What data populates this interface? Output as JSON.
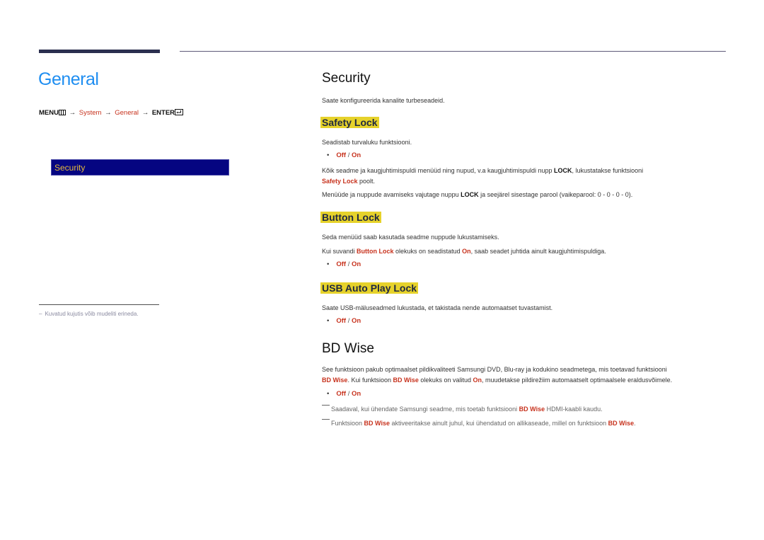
{
  "chapter": {
    "title": "General",
    "menu_path": {
      "menu": "MENU",
      "arrow": "→",
      "system": "System",
      "general": "General",
      "enter": "ENTER"
    },
    "osd_item": "Security",
    "side_note_dash": "–",
    "side_note": "Kuvatud kujutis võib mudeliti erineda."
  },
  "security": {
    "title": "Security",
    "intro": "Saate konfigureerida kanalite turbeseadeid.",
    "safety_lock": {
      "title": "Safety Lock",
      "desc": "Seadistab turvaluku funktsiooni.",
      "options": {
        "off": "Off",
        "sep": "/",
        "on": "On"
      },
      "p1_a": "Kõik seadme ja kaugjuhtimispuldi menüüd ning nupud, v.a kaugjuhtimispuldi nupp ",
      "p1_lock": "LOCK",
      "p1_b": ", lukustatakse funktsiooni",
      "p1_c_red": "Safety Lock",
      "p1_d": " poolt.",
      "p2_a": "Menüüde ja nuppude avamiseks vajutage nuppu ",
      "p2_lock": "LOCK",
      "p2_b": " ja seejärel sisestage parool (vaikeparool: 0 - 0 - 0 - 0)."
    },
    "button_lock": {
      "title": "Button Lock",
      "desc": "Seda menüüd saab kasutada seadme nuppude lukustamiseks.",
      "p_a": "Kui suvandi ",
      "p_red1": "Button Lock",
      "p_b": " olekuks on seadistatud ",
      "p_red2": "On",
      "p_c": ", saab seadet juhtida ainult kaugjuhtimispuldiga.",
      "options": {
        "off": "Off",
        "sep": "/",
        "on": "On"
      }
    },
    "usb_lock": {
      "title": "USB Auto Play Lock",
      "desc": "Saate USB-mäluseadmed lukustada, et takistada nende automaatset tuvastamist.",
      "options": {
        "off": "Off",
        "sep": "/",
        "on": "On"
      }
    }
  },
  "bd_wise": {
    "title": "BD Wise",
    "p1": "See funktsioon pakub optimaalset pildikvaliteeti Samsungi DVD, Blu-ray ja kodukino seadmetega, mis toetavad funktsiooni",
    "p2_red1": "BD Wise",
    "p2_a": ". Kui funktsioon ",
    "p2_red2": "BD Wise",
    "p2_b": " olekuks on valitud ",
    "p2_red3": "On",
    "p2_c": ", muudetakse pildirežiim automaatselt optimaalsele eraldusvõimele.",
    "options": {
      "off": "Off",
      "sep": "/",
      "on": "On"
    },
    "note1_a": "Saadaval, kui ühendate Samsungi seadme, mis toetab funktsiooni ",
    "note1_red": "BD Wise",
    "note1_b": " HDMI-kaabli kaudu.",
    "note2_a": "Funktsioon ",
    "note2_red1": "BD Wise",
    "note2_b": " aktiveeritakse ainult juhul, kui ühendatud on allikaseade, millel on funktsioon ",
    "note2_red2": "BD Wise",
    "note2_c": "."
  }
}
